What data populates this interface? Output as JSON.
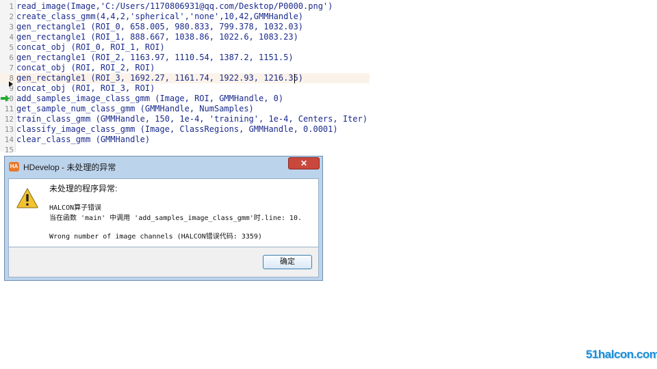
{
  "editor": {
    "lines": [
      {
        "num": "1",
        "text": "read_image(Image,'C:/Users/1170806931@qq.com/Desktop/P0000.png')"
      },
      {
        "num": "2",
        "text": "create_class_gmm(4,4,2,'spherical','none',10,42,GMMHandle)"
      },
      {
        "num": "3",
        "text": "gen_rectangle1 (ROI_0, 658.005, 980.833, 799.378, 1032.03)"
      },
      {
        "num": "4",
        "text": "gen_rectangle1 (ROI_1, 888.667, 1038.86, 1022.6, 1083.23)"
      },
      {
        "num": "5",
        "text": "concat_obj (ROI_0, ROI_1, ROI)"
      },
      {
        "num": "6",
        "text": "gen_rectangle1 (ROI_2, 1163.97, 1110.54, 1387.2, 1151.5)"
      },
      {
        "num": "7",
        "text": "concat_obj (ROI, ROI_2, ROI)"
      },
      {
        "num": "8",
        "text": "gen_rectangle1 (ROI_3, 1692.27, 1161.74, 1922.93, 1216.35)"
      },
      {
        "num": "9",
        "text": "concat_obj (ROI, ROI_3, ROI)"
      },
      {
        "num": "10",
        "text": "add_samples_image_class_gmm (Image, ROI, GMMHandle, 0)"
      },
      {
        "num": "11",
        "text": "get_sample_num_class_gmm (GMMHandle, NumSamples)"
      },
      {
        "num": "12",
        "text": "train_class_gmm (GMMHandle, 150, 1e-4, 'training', 1e-4, Centers, Iter)"
      },
      {
        "num": "13",
        "text": "classify_image_class_gmm (Image, ClassRegions, GMMHandle, 0.0001)"
      },
      {
        "num": "14",
        "text": "clear_class_gmm (GMMHandle)"
      },
      {
        "num": "15",
        "text": ""
      }
    ],
    "current_line_index": 7
  },
  "dialog": {
    "app_logo": "HA",
    "title": "HDevelop - 未处理的异常",
    "close_label": "✕",
    "heading": "未处理的程序异常:",
    "message_1": "HALCON算子错误",
    "message_2": "当在函数 'main' 中调用 'add_samples_image_class_gmm'时.line: 10.",
    "message_3": "Wrong number of image channels (HALCON错误代码: 3359)",
    "ok_label": "确定",
    "icon": "warning-icon"
  },
  "watermark": "51halcon.com",
  "colors": {
    "code_text": "#1a2a8c",
    "current_line": "#fbf3ea",
    "dialog_frame": "#bcd3ec",
    "close_button": "#c9483c",
    "watermark": "#1f8fd8"
  }
}
